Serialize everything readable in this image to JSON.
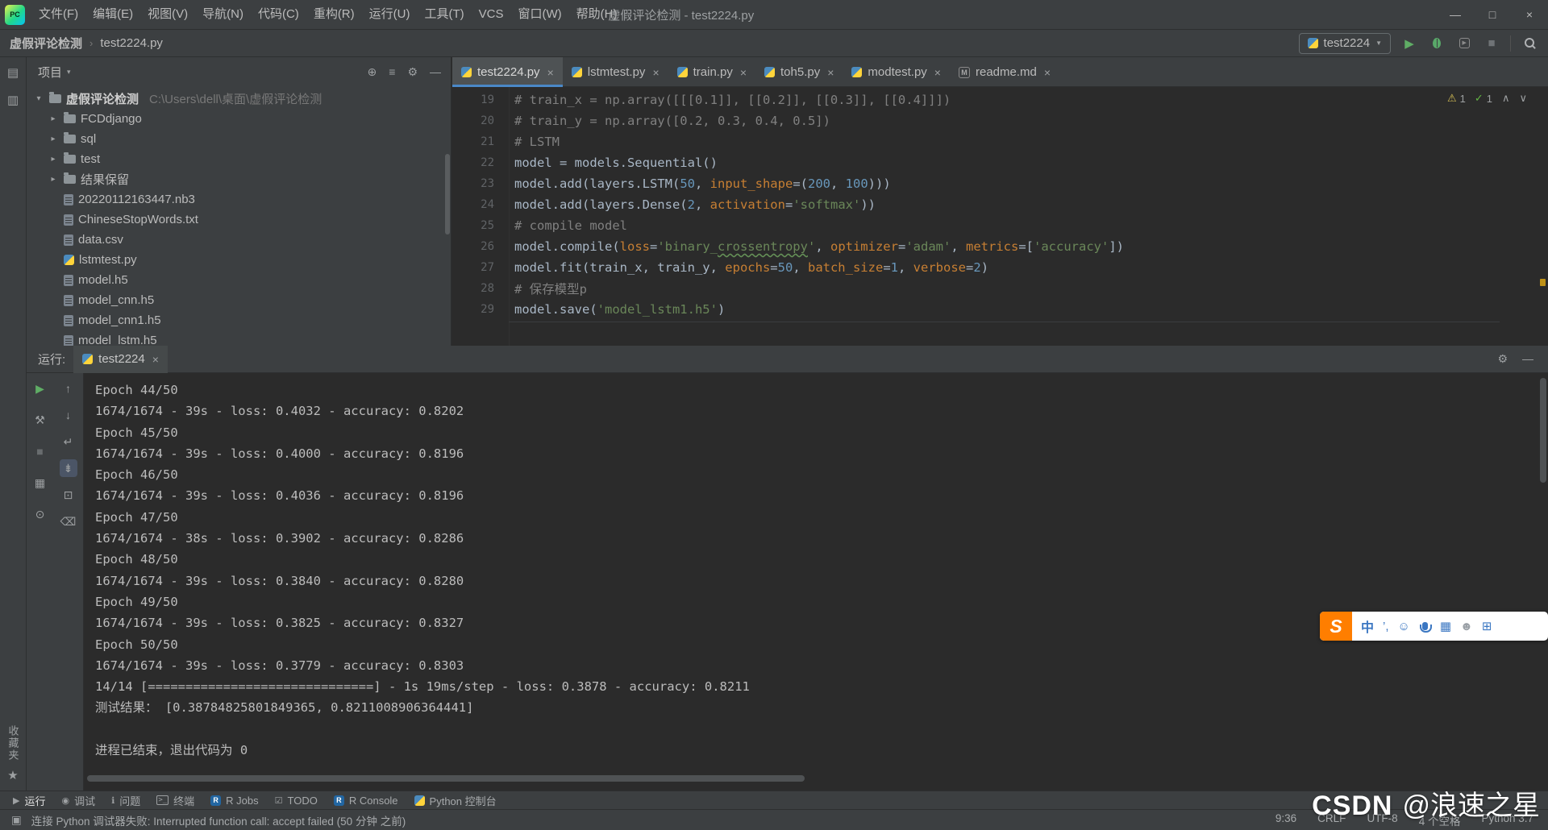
{
  "colors": {
    "panel_bg": "#3c3f41",
    "editor_bg": "#2b2b2b",
    "accent_blue": "#4a88c7",
    "run_green": "#5fad65",
    "warning_yellow": "#d6bf55",
    "error_stripe_orange": "#be9117",
    "string_green": "#6a8759",
    "number_blue": "#6897bb",
    "comment_gray": "#808080",
    "kwarg_orange": "#c77f33",
    "ime_orange": "#ff7e00",
    "ime_blue": "#3b77c2"
  },
  "icons": {
    "app": "PC",
    "minimize": "—",
    "maximize": "□",
    "close": "×",
    "crumb_sep": "›",
    "combo_arrow": "▼",
    "run_play": "▶",
    "stop": "■",
    "project_caret": "▾",
    "locate": "⊕",
    "collapse_all": "≡",
    "gear": "⚙",
    "hide": "—",
    "expanded": "▾",
    "collapsed": "▸",
    "warning": "⚠",
    "ok_check": "✓",
    "chev_up": "∧",
    "chev_down": "∨",
    "tab_close": "×",
    "markdown": "M",
    "star": "★",
    "stripe_project": "▤",
    "stripe_structure": "▥",
    "statusbar_corner": "▣"
  },
  "title_bar": {
    "menus": [
      "文件(F)",
      "编辑(E)",
      "视图(V)",
      "导航(N)",
      "代码(C)",
      "重构(R)",
      "运行(U)",
      "工具(T)",
      "VCS",
      "窗口(W)",
      "帮助(H)"
    ],
    "title": "虚假评论检测 - test2224.py"
  },
  "nav_bar": {
    "crumb_root": "虚假评论检测",
    "crumb_file": "test2224.py",
    "run_config": "test2224"
  },
  "left_stripe": {
    "bottom_label": "收藏夹"
  },
  "project_panel": {
    "header": "项目",
    "tree": [
      {
        "type": "root",
        "label": "虚假评论检测",
        "path": "C:\\Users\\dell\\桌面\\虚假评论检测"
      },
      {
        "type": "folder",
        "label": "FCDdjango"
      },
      {
        "type": "folder",
        "label": "sql"
      },
      {
        "type": "folder",
        "label": "test"
      },
      {
        "type": "folder",
        "label": "结果保留"
      },
      {
        "type": "file",
        "ext": "nb3",
        "label": "20220112163447.nb3"
      },
      {
        "type": "file",
        "ext": "txt",
        "label": "ChineseStopWords.txt"
      },
      {
        "type": "file",
        "ext": "csv",
        "label": "data.csv"
      },
      {
        "type": "file",
        "ext": "py",
        "label": "lstmtest.py"
      },
      {
        "type": "file",
        "ext": "h5",
        "label": "model.h5"
      },
      {
        "type": "file",
        "ext": "h5",
        "label": "model_cnn.h5"
      },
      {
        "type": "file",
        "ext": "h5",
        "label": "model_cnn1.h5"
      },
      {
        "type": "file",
        "ext": "h5",
        "label": "model_lstm.h5"
      }
    ]
  },
  "editor": {
    "tabs": [
      {
        "label": "test2224.py",
        "icon": "py",
        "active": true
      },
      {
        "label": "lstmtest.py",
        "icon": "py"
      },
      {
        "label": "train.py",
        "icon": "py"
      },
      {
        "label": "toh5.py",
        "icon": "py"
      },
      {
        "label": "modtest.py",
        "icon": "py"
      },
      {
        "label": "readme.md",
        "icon": "md"
      }
    ],
    "inspection": {
      "warnings": "1",
      "ok": "1"
    },
    "code_lines": [
      {
        "n": "19",
        "seg": [
          [
            "c",
            "# train_x = np.array([[[0.1]], [[0.2]], [[0.3]], [[0.4]]])"
          ]
        ]
      },
      {
        "n": "20",
        "seg": [
          [
            "c",
            "# train_y = np.array([0.2, 0.3, 0.4, 0.5])"
          ]
        ]
      },
      {
        "n": "21",
        "seg": [
          [
            "c",
            "# LSTM"
          ]
        ]
      },
      {
        "n": "22",
        "seg": [
          [
            "p",
            "model = models.Sequential()"
          ]
        ]
      },
      {
        "n": "23",
        "seg": [
          [
            "p",
            "model.add(layers.LSTM("
          ],
          [
            "n",
            "50"
          ],
          [
            "p",
            ", "
          ],
          [
            "k",
            "input_shape"
          ],
          [
            "p",
            "=("
          ],
          [
            "n",
            "200"
          ],
          [
            "p",
            ", "
          ],
          [
            "n",
            "100"
          ],
          [
            "p",
            ")))"
          ]
        ]
      },
      {
        "n": "24",
        "seg": [
          [
            "p",
            "model.add(layers.Dense("
          ],
          [
            "n",
            "2"
          ],
          [
            "p",
            ", "
          ],
          [
            "k",
            "activation"
          ],
          [
            "p",
            "="
          ],
          [
            "s",
            "'softmax'"
          ],
          [
            "p",
            "))"
          ]
        ]
      },
      {
        "n": "25",
        "seg": [
          [
            "c",
            "# compile model"
          ]
        ]
      },
      {
        "n": "26",
        "seg": [
          [
            "p",
            "model.compile("
          ],
          [
            "k",
            "loss"
          ],
          [
            "p",
            "="
          ],
          [
            "s",
            "'binary_"
          ],
          [
            "sw",
            "crossentropy"
          ],
          [
            "s",
            "'"
          ],
          [
            "p",
            ", "
          ],
          [
            "k",
            "optimizer"
          ],
          [
            "p",
            "="
          ],
          [
            "s",
            "'adam'"
          ],
          [
            "p",
            ", "
          ],
          [
            "k",
            "metrics"
          ],
          [
            "p",
            "=["
          ],
          [
            "s",
            "'accuracy'"
          ],
          [
            "p",
            "])"
          ]
        ]
      },
      {
        "n": "27",
        "seg": [
          [
            "p",
            "model.fit(train_x, train_y, "
          ],
          [
            "k",
            "epochs"
          ],
          [
            "p",
            "="
          ],
          [
            "n",
            "50"
          ],
          [
            "p",
            ", "
          ],
          [
            "k",
            "batch_size"
          ],
          [
            "p",
            "="
          ],
          [
            "n",
            "1"
          ],
          [
            "p",
            ", "
          ],
          [
            "k",
            "verbose"
          ],
          [
            "p",
            "="
          ],
          [
            "n",
            "2"
          ],
          [
            "p",
            ")"
          ]
        ]
      },
      {
        "n": "28",
        "seg": [
          [
            "c",
            "# 保存模型p"
          ]
        ]
      },
      {
        "n": "29",
        "seg": [
          [
            "p",
            "model.save("
          ],
          [
            "s",
            "'model_lstm1.h5'"
          ],
          [
            "p",
            ")"
          ]
        ]
      }
    ]
  },
  "run_panel": {
    "label": "运行:",
    "tab": "test2224",
    "toolbar_left": [
      {
        "name": "rerun-icon",
        "glyph": "▶",
        "cls": "green"
      },
      {
        "name": "wrench-icon",
        "glyph": "⚒"
      },
      {
        "name": "stop-icon",
        "glyph": "■",
        "cls": "dim"
      },
      {
        "name": "restore-layout-icon",
        "glyph": "▦"
      },
      {
        "name": "pin-icon",
        "glyph": "⊙"
      }
    ],
    "toolbar_console": [
      {
        "name": "up-stack-icon",
        "glyph": "↑"
      },
      {
        "name": "down-stack-icon",
        "glyph": "↓"
      },
      {
        "name": "soft-wrap-icon",
        "glyph": "↵"
      },
      {
        "name": "scroll-to-end-icon",
        "glyph": "⇟",
        "cls": "sel"
      },
      {
        "name": "print-icon",
        "glyph": "⊡"
      },
      {
        "name": "clear-all-icon",
        "glyph": "⌫"
      }
    ],
    "console": [
      "Epoch 44/50",
      "1674/1674 - 39s - loss: 0.4032 - accuracy: 0.8202",
      "Epoch 45/50",
      "1674/1674 - 39s - loss: 0.4000 - accuracy: 0.8196",
      "Epoch 46/50",
      "1674/1674 - 39s - loss: 0.4036 - accuracy: 0.8196",
      "Epoch 47/50",
      "1674/1674 - 38s - loss: 0.3902 - accuracy: 0.8286",
      "Epoch 48/50",
      "1674/1674 - 39s - loss: 0.3840 - accuracy: 0.8280",
      "Epoch 49/50",
      "1674/1674 - 39s - loss: 0.3825 - accuracy: 0.8327",
      "Epoch 50/50",
      "1674/1674 - 39s - loss: 0.3779 - accuracy: 0.8303",
      "14/14 [==============================] - 1s 19ms/step - loss: 0.3878 - accuracy: 0.8211",
      "测试结果： [0.38784825801849365, 0.8211008906364441]",
      "",
      "进程已结束，退出代码为 0"
    ]
  },
  "bottom_bar": {
    "items": [
      {
        "label": "运行",
        "glyph": "▶",
        "icon_name": "run-toolwindow-icon",
        "active": true
      },
      {
        "label": "调试",
        "glyph": "◉",
        "icon_name": "debug-toolwindow-icon"
      },
      {
        "label": "问题",
        "glyph": "ℹ",
        "icon_name": "problems-toolwindow-icon"
      },
      {
        "label": "终端",
        "glyph": ">_",
        "icon_name": "terminal-toolwindow-icon",
        "cls": "term"
      },
      {
        "label": "R Jobs",
        "glyph": "R",
        "icon_name": "r-jobs-toolwindow-icon",
        "cls": "badge"
      },
      {
        "label": "TODO",
        "glyph": "☑",
        "icon_name": "todo-toolwindow-icon"
      },
      {
        "label": "R Console",
        "glyph": "R",
        "icon_name": "r-console-toolwindow-icon",
        "cls": "badge"
      },
      {
        "label": "Python 控制台",
        "glyph": "py",
        "icon_name": "python-console-icon",
        "cls": "py"
      }
    ]
  },
  "status_bar": {
    "message": "连接 Python 调试器失败: Interrupted function call: accept failed (50 分钟 之前)",
    "items": [
      {
        "name": "status-caret-position",
        "label": "9:36"
      },
      {
        "name": "status-line-ending",
        "label": "CRLF"
      },
      {
        "name": "status-encoding",
        "label": "UTF-8"
      },
      {
        "name": "status-indent",
        "label": "4 个空格"
      },
      {
        "name": "status-interpreter",
        "label": "Python 3.7"
      }
    ]
  },
  "watermark": {
    "brand": "CSDN",
    "user": "@浪速之星"
  },
  "ime_bar": {
    "logo": "S",
    "items": [
      {
        "glyph": "中",
        "name": "ime-language-icon",
        "cls": "zh"
      },
      {
        "glyph": "’,",
        "name": "ime-punctuation-icon"
      },
      {
        "glyph": "☺",
        "name": "ime-emoji-icon"
      },
      {
        "glyph": "mic",
        "name": "ime-voice-icon"
      },
      {
        "glyph": "▦",
        "name": "ime-keyboard-icon"
      },
      {
        "glyph": "☻",
        "name": "ime-account-icon",
        "cls": "gray"
      },
      {
        "glyph": "⊞",
        "name": "ime-toolbox-icon"
      }
    ]
  }
}
